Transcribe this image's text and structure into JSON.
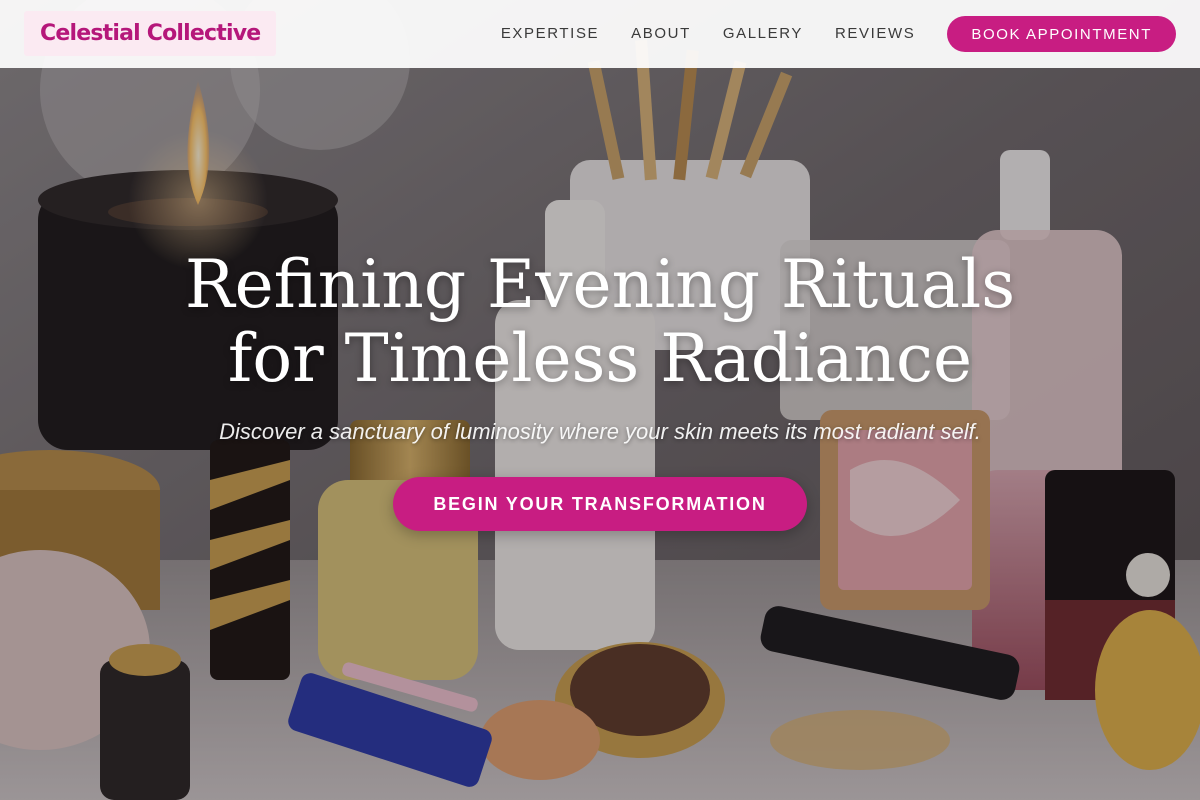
{
  "header": {
    "logo_text": "Celestial Collective",
    "nav": [
      {
        "label": "EXPERTISE"
      },
      {
        "label": "ABOUT"
      },
      {
        "label": "GALLERY"
      },
      {
        "label": "REVIEWS"
      }
    ],
    "cta_label": "BOOK APPOINTMENT"
  },
  "hero": {
    "title_line1": "Refining Evening Rituals",
    "title_line2": "for Timeless Radiance",
    "subtitle": "Discover a sanctuary of luminosity where your skin meets its most radiant self.",
    "cta_label": "BEGIN YOUR TRANSFORMATION"
  },
  "colors": {
    "accent": "#c81d82",
    "logo_text": "#b5177a",
    "logo_bg": "#fbeaf2",
    "nav_text": "#3a3a3a"
  }
}
